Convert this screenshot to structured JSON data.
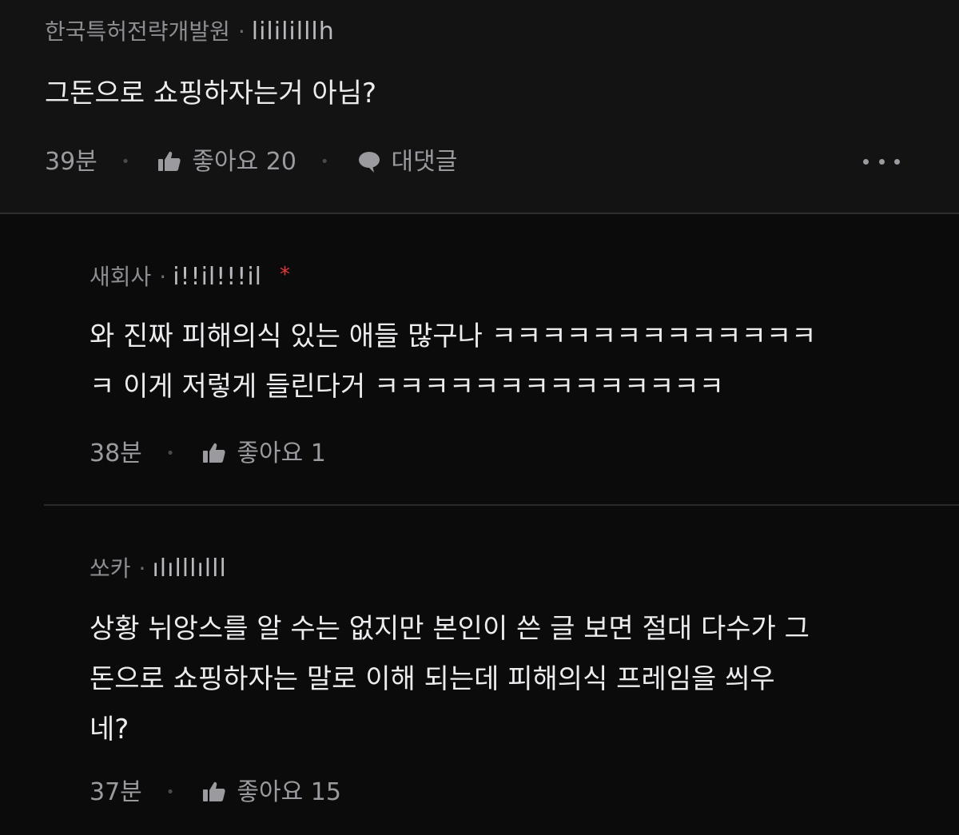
{
  "comments": [
    {
      "author": "한국특허전략개발원",
      "handle": "lilililllh",
      "text": "그돈으로 쇼핑하자는거 아님?",
      "time": "39분",
      "like_label": "좋아요 20",
      "reply_label": "대댓글"
    },
    {
      "author": "새회사",
      "handle": "i!!il!!!il",
      "badge": "*",
      "text": "와 진짜 피해의식 있는 애들 많구나 ㅋㅋㅋㅋㅋㅋㅋㅋㅋㅋㅋㅋㅋ\nㅋ 이게 저렇게 들린다거 ㅋㅋㅋㅋㅋㅋㅋㅋㅋㅋㅋㅋㅋㅋ",
      "time": "38분",
      "like_label": "좋아요 1"
    },
    {
      "author": "쏘카",
      "handle": "ılılllılll",
      "text": "상황 뉘앙스를 알 수는 없지만 본인이 쓴 글 보면 절대 다수가 그\n돈으로 쇼핑하자는 말로 이해 되는데 피해의식 프레임을 씌우\n네?",
      "time": "37분",
      "like_label": "좋아요 15"
    }
  ],
  "icons": {
    "like": "thumbs-up-icon",
    "reply": "speech-bubble-icon",
    "more": "more-dots-icon"
  },
  "colors": {
    "background": "#0b0b0c",
    "top_comment_bg": "#131314",
    "badge": "#e23a3a"
  }
}
